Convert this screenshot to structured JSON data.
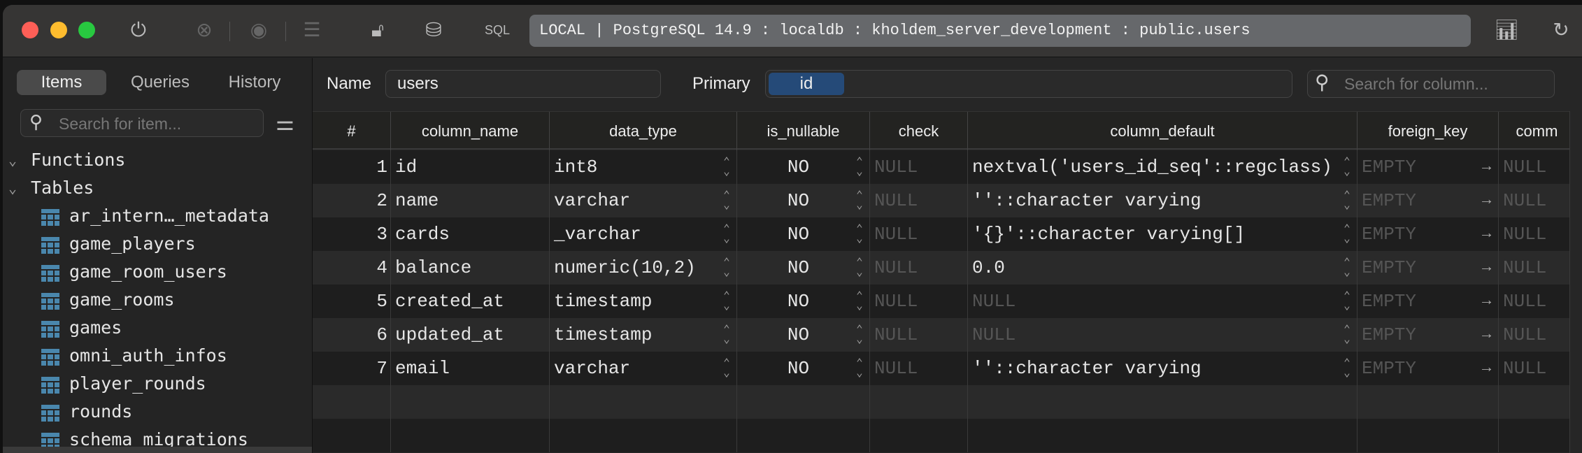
{
  "toolbar": {
    "sql_label": "SQL",
    "address": "LOCAL | PostgreSQL 14.9 : localdb : kholdem_server_development : public.users"
  },
  "sidebar": {
    "tabs": [
      "Items",
      "Queries",
      "History"
    ],
    "search_placeholder": "Search for item...",
    "groups": [
      "Functions",
      "Tables"
    ],
    "tables": [
      "ar_intern…_metadata",
      "game_players",
      "game_room_users",
      "game_rooms",
      "games",
      "omni_auth_infos",
      "player_rounds",
      "rounds",
      "schema_migrations"
    ]
  },
  "main": {
    "name_label": "Name",
    "name_value": "users",
    "primary_label": "Primary",
    "primary_value": "id",
    "column_search_placeholder": "Search for column...",
    "headers": [
      "#",
      "column_name",
      "data_type",
      "is_nullable",
      "check",
      "column_default",
      "foreign_key",
      "comm"
    ],
    "rows": [
      {
        "n": "1",
        "name": "id",
        "type": "int8",
        "nullable": "NO",
        "check": "NULL",
        "default": "nextval('users_id_seq'::regclass)",
        "fk": "EMPTY",
        "comment": "NULL"
      },
      {
        "n": "2",
        "name": "name",
        "type": "varchar",
        "nullable": "NO",
        "check": "NULL",
        "default": "''::character varying",
        "fk": "EMPTY",
        "comment": "NULL"
      },
      {
        "n": "3",
        "name": "cards",
        "type": "_varchar",
        "nullable": "NO",
        "check": "NULL",
        "default": "'{}'::character varying[]",
        "fk": "EMPTY",
        "comment": "NULL"
      },
      {
        "n": "4",
        "name": "balance",
        "type": "numeric(10,2)",
        "nullable": "NO",
        "check": "NULL",
        "default": "0.0",
        "fk": "EMPTY",
        "comment": "NULL"
      },
      {
        "n": "5",
        "name": "created_at",
        "type": "timestamp",
        "nullable": "NO",
        "check": "NULL",
        "default": "NULL",
        "fk": "EMPTY",
        "comment": "NULL"
      },
      {
        "n": "6",
        "name": "updated_at",
        "type": "timestamp",
        "nullable": "NO",
        "check": "NULL",
        "default": "NULL",
        "fk": "EMPTY",
        "comment": "NULL"
      },
      {
        "n": "7",
        "name": "email",
        "type": "varchar",
        "nullable": "NO",
        "check": "NULL",
        "default": "''::character varying",
        "fk": "EMPTY",
        "comment": "NULL"
      }
    ]
  },
  "colors": {
    "close": "#fe5f57",
    "minimize": "#febc2e",
    "zoom": "#28c840",
    "table_icon": "#4a87ad",
    "primary_chip": "#254a78"
  }
}
